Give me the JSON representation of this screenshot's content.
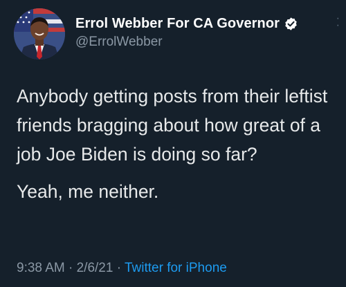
{
  "author": {
    "display_name": "Errol Webber For CA Governor",
    "handle": "@ErrolWebber",
    "verified": true,
    "avatar_icon": "profile-photo"
  },
  "more_icon": "ellipsis-icon",
  "tweet": {
    "paragraphs": [
      "Anybody getting posts from their leftist friends bragging about how great of a job Joe Biden is doing so far?",
      "Yeah, me neither."
    ]
  },
  "meta": {
    "time": "9:38 AM",
    "separator": "·",
    "date": "2/6/21",
    "source": "Twitter for iPhone"
  },
  "colors": {
    "background": "#15202b",
    "text": "#e7e9ea",
    "secondary": "#8b98a5",
    "accent": "#1d9bf0"
  }
}
